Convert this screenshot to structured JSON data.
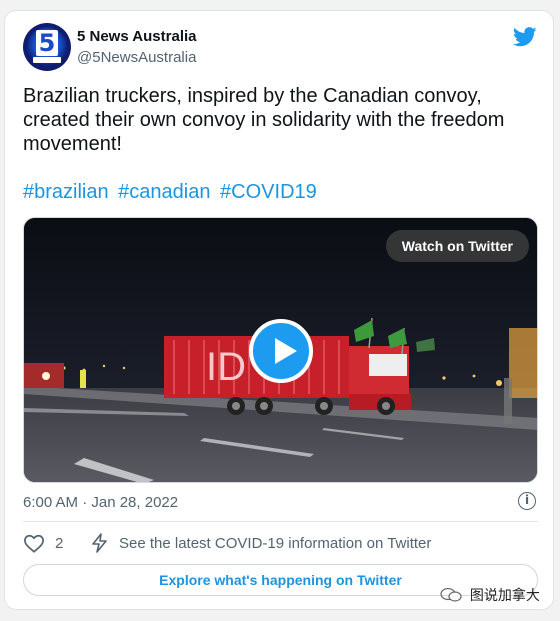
{
  "author": {
    "name": "5 News Australia",
    "handle": "@5NewsAustralia",
    "avatar_text": "5"
  },
  "tweet": {
    "text": "Brazilian truckers, inspired by the Canadian convoy, created their own convoy in solidarity with the freedom movement!",
    "hashtags": [
      "#brazilian",
      "#canadian",
      "#COVID19"
    ]
  },
  "media": {
    "watch_label": "Watch on Twitter",
    "truck_text": "ID"
  },
  "meta": {
    "timestamp": "6:00 AM · Jan 28, 2022",
    "info_icon": "i"
  },
  "actions": {
    "likes": "2",
    "covid_link": "See the latest COVID-19 information on Twitter"
  },
  "explore_label": "Explore what's happening on Twitter",
  "watermark": "图说加拿大",
  "colors": {
    "accent": "#1b95e0",
    "play_button": "#1d9bf0",
    "muted_text": "#536471",
    "truck": "#c8202a"
  },
  "icons": [
    "twitter-bird-icon",
    "play-icon",
    "info-icon",
    "heart-icon",
    "lightning-icon",
    "wechat-icon"
  ]
}
